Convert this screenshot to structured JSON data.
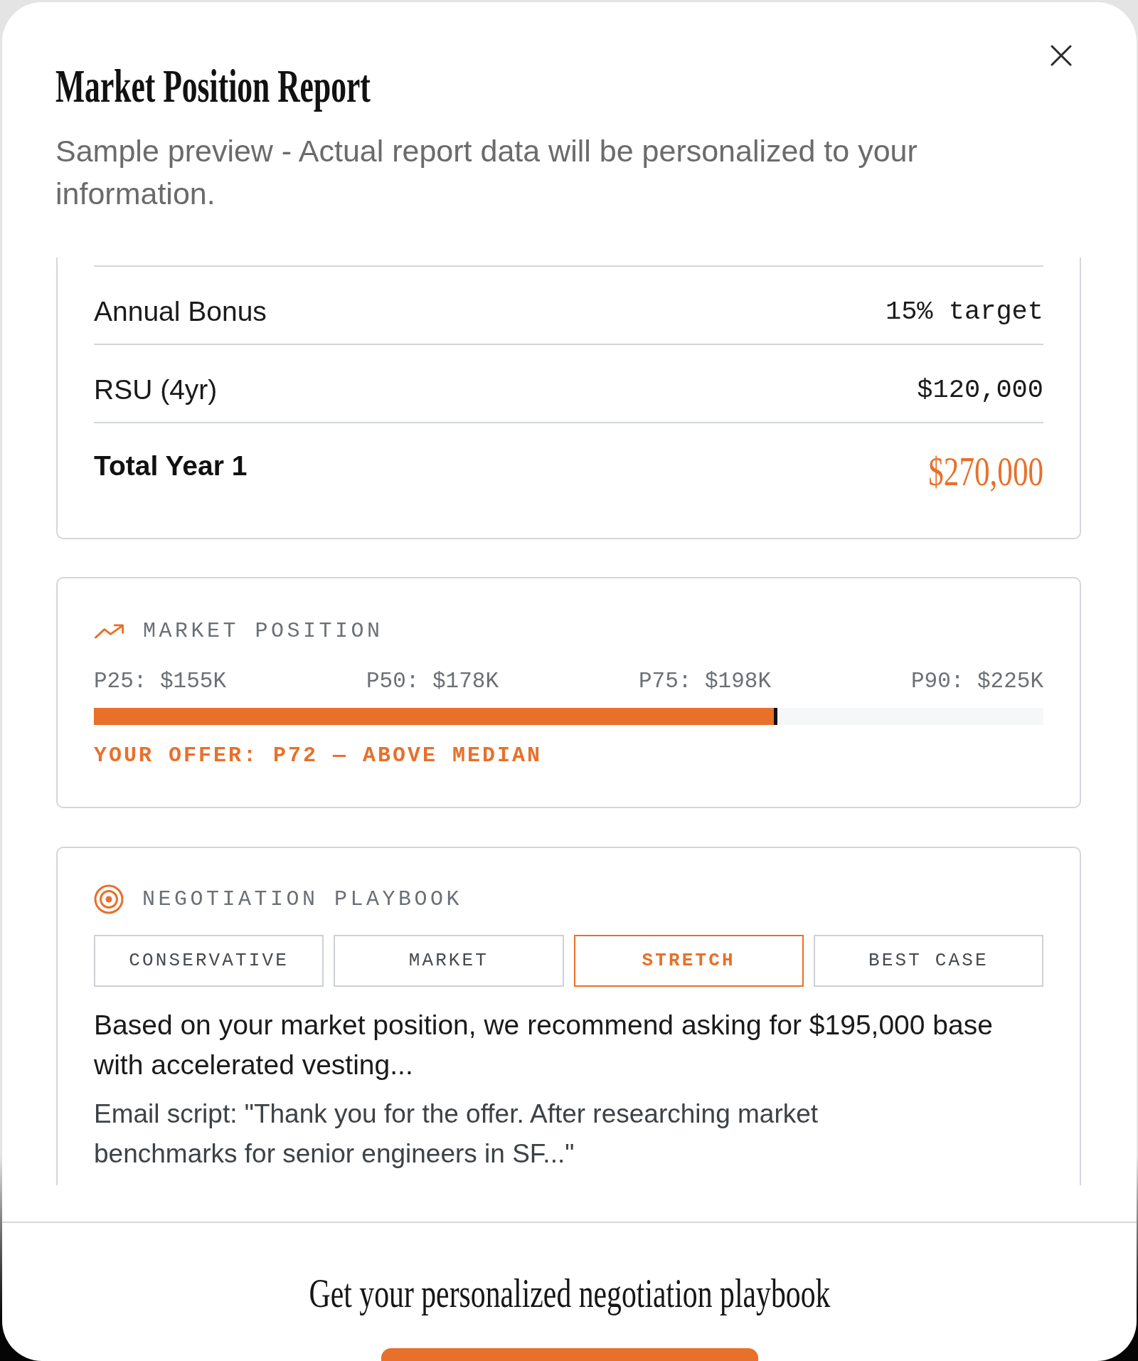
{
  "dialog": {
    "title": "Market Position Report",
    "subtitle": "Sample preview - Actual report data will be personalized to your information."
  },
  "compensation": {
    "rows": [
      {
        "kind": "item",
        "label": "Annual Bonus",
        "value": "15% target"
      },
      {
        "kind": "item",
        "label": "RSU (4yr)",
        "value": "$120,000"
      },
      {
        "kind": "total",
        "label": "Total Year 1",
        "value": "$270,000"
      }
    ]
  },
  "market_position": {
    "heading": "MARKET POSITION",
    "percentiles": [
      "P25: $155K",
      "P50: $178K",
      "P75: $198K",
      "P90: $225K"
    ],
    "offer_bar": {
      "level": 0.72
    },
    "offer_note": "YOUR OFFER: P72 — ABOVE MEDIAN"
  },
  "playbook": {
    "heading": "NEGOTIATION PLAYBOOK",
    "tabs": [
      {
        "label": "CONSERVATIVE",
        "selected": false
      },
      {
        "label": "MARKET",
        "selected": false
      },
      {
        "label": "STRETCH",
        "selected": true
      },
      {
        "label": "BEST CASE",
        "selected": false
      }
    ],
    "recommendation": "Based on your market position, we recommend asking for $195,000 base with accelerated vesting...",
    "email_script": "Email script: \"Thank you for the offer. After researching market benchmarks for senior engineers in SF...\""
  },
  "footer": {
    "prompt": "Get your personalized negotiation playbook"
  }
}
